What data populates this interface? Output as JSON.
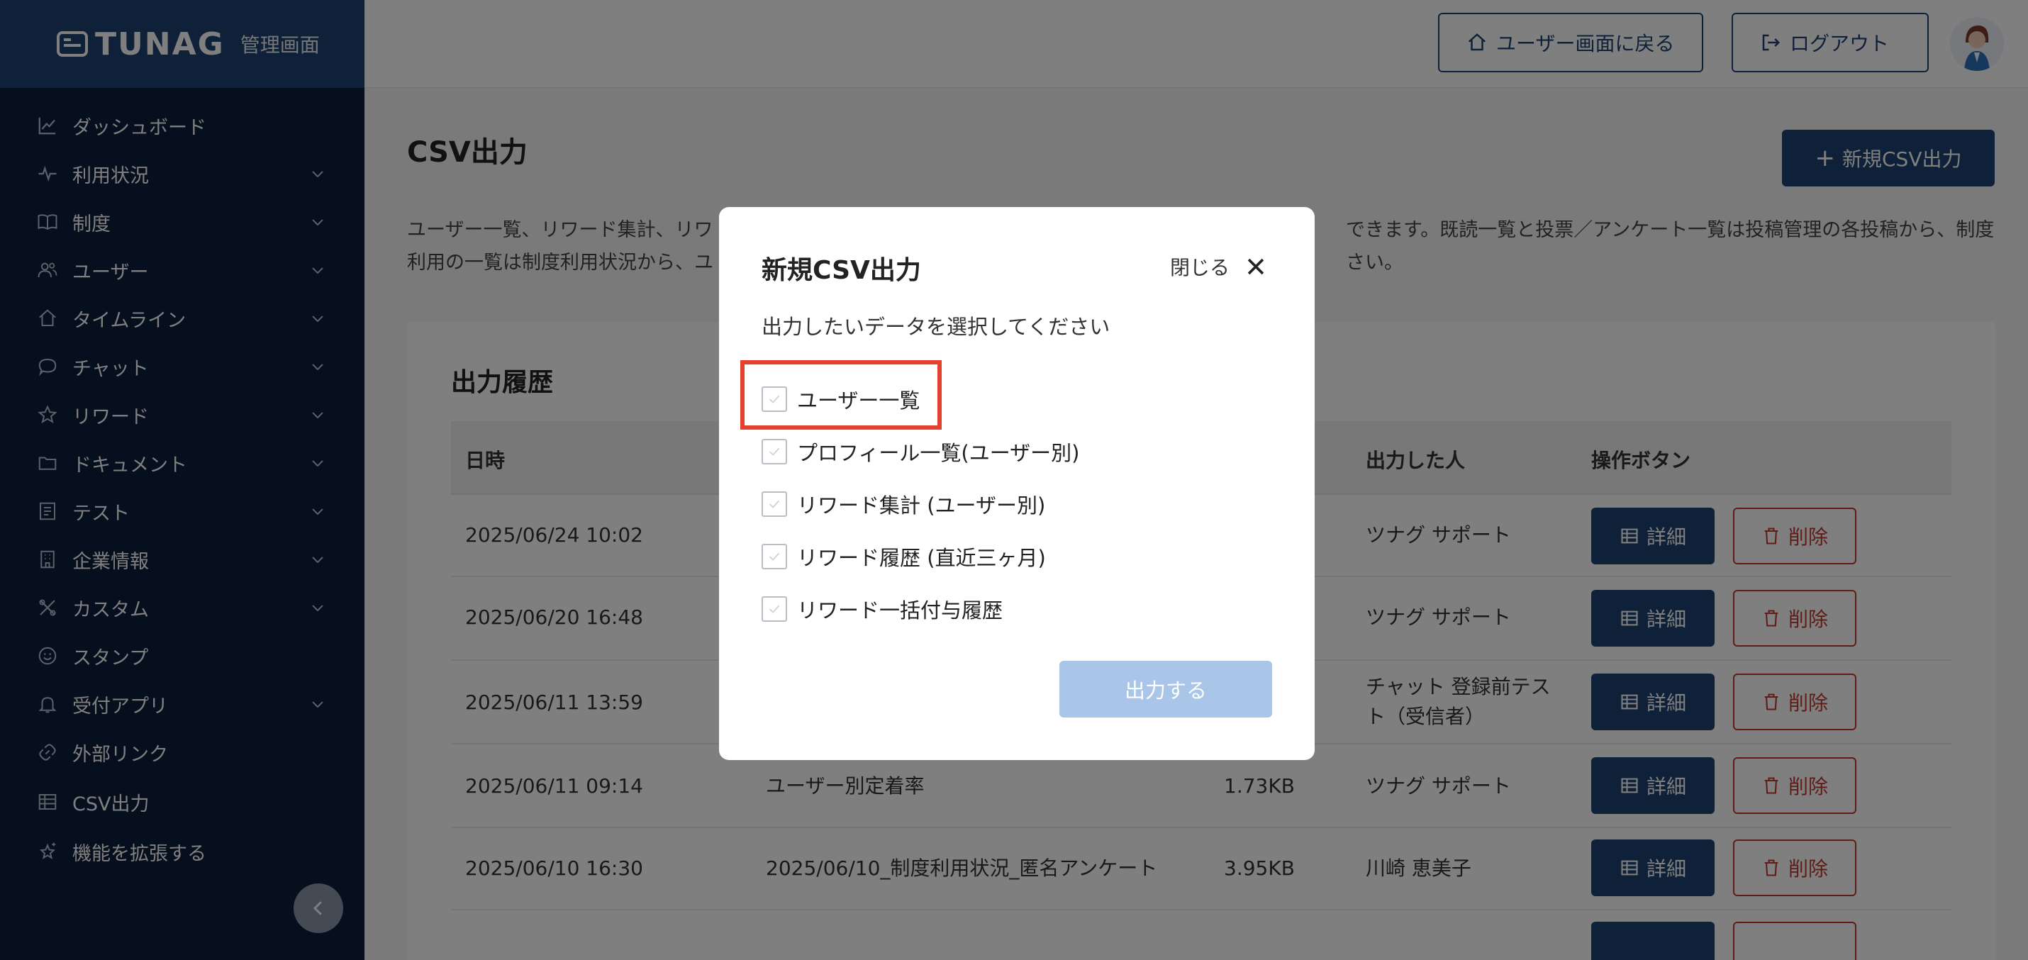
{
  "brand": {
    "name": "TUNAG",
    "subtitle": "管理画面"
  },
  "topbar": {
    "home_label": "ユーザー画面に戻る",
    "logout_label": "ログアウト"
  },
  "sidebar": {
    "items": [
      {
        "label": "ダッシュボード",
        "icon": "chart-line-icon",
        "chevron": false
      },
      {
        "label": "利用状況",
        "icon": "pulse-icon",
        "chevron": true
      },
      {
        "label": "制度",
        "icon": "book-icon",
        "chevron": true
      },
      {
        "label": "ユーザー",
        "icon": "users-icon",
        "chevron": true
      },
      {
        "label": "タイムライン",
        "icon": "home-icon",
        "chevron": true
      },
      {
        "label": "チャット",
        "icon": "chat-bubble-icon",
        "chevron": true
      },
      {
        "label": "リワード",
        "icon": "star-icon",
        "chevron": true
      },
      {
        "label": "ドキュメント",
        "icon": "folder-icon",
        "chevron": true
      },
      {
        "label": "テスト",
        "icon": "checklist-icon",
        "chevron": true
      },
      {
        "label": "企業情報",
        "icon": "building-icon",
        "chevron": true
      },
      {
        "label": "カスタム",
        "icon": "tools-icon",
        "chevron": true
      },
      {
        "label": "スタンプ",
        "icon": "smile-icon",
        "chevron": false
      },
      {
        "label": "受付アプリ",
        "icon": "bell-icon",
        "chevron": true
      },
      {
        "label": "外部リンク",
        "icon": "link-icon",
        "chevron": false
      },
      {
        "label": "CSV出力",
        "icon": "table-icon",
        "chevron": false
      },
      {
        "label": "機能を拡張する",
        "icon": "sparkle-star-icon",
        "chevron": false
      }
    ]
  },
  "main": {
    "title": "CSV出力",
    "new_button_label": "新規CSV出力",
    "description_line1": "ユーザー一覧、リワード集計、リワ",
    "description_line1_tail": "できます。既読一覧と投票／アンケート一覧は投稿管理の各投稿から、制度",
    "description_line2": "利用の一覧は制度利用状況から、ユ",
    "description_line2_tail": "さい。"
  },
  "history": {
    "title": "出力履歴",
    "columns": {
      "datetime": "日時",
      "person": "出力した人",
      "actions": "操作ボタン"
    },
    "detail_label": "詳細",
    "delete_label": "削除",
    "rows": [
      {
        "datetime": "2025/06/24 10:02",
        "name": "",
        "size": "",
        "person": "ツナグ サポート"
      },
      {
        "datetime": "2025/06/20 16:48",
        "name": "",
        "size": "",
        "person": "ツナグ サポート"
      },
      {
        "datetime": "2025/06/11 13:59",
        "name": "",
        "size": "",
        "person": "チャット 登録前テスト（受信者）",
        "person_line1": "チャット 登録前テス",
        "person_line2": "ト（受信者）"
      },
      {
        "datetime": "2025/06/11 09:14",
        "name": "ユーザー別定着率",
        "size": "1.73KB",
        "person": "ツナグ サポート"
      },
      {
        "datetime": "2025/06/10 16:30",
        "name": "2025/06/10_制度利用状況_匿名アンケート",
        "size": "3.95KB",
        "person": "川崎 恵美子"
      }
    ]
  },
  "modal": {
    "title": "新規CSV出力",
    "close_label": "閉じる",
    "prompt": "出力したいデータを選択してください",
    "options": [
      {
        "label": "ユーザー一覧",
        "checked": false
      },
      {
        "label": "プロフィール一覧(ユーザー別)",
        "checked": false
      },
      {
        "label": "リワード集計 (ユーザー別)",
        "checked": false
      },
      {
        "label": "リワード履歴 (直近三ヶ月)",
        "checked": false
      },
      {
        "label": "リワード一括付与履歴",
        "checked": false
      }
    ],
    "submit_label": "出力する"
  },
  "colors": {
    "brand_navy": "#1d4370",
    "sidebar_bg": "#0d1f3c",
    "delete_red": "#c0392b",
    "highlight_red": "#e5412c",
    "submit_disabled": "#a9c6e8"
  }
}
